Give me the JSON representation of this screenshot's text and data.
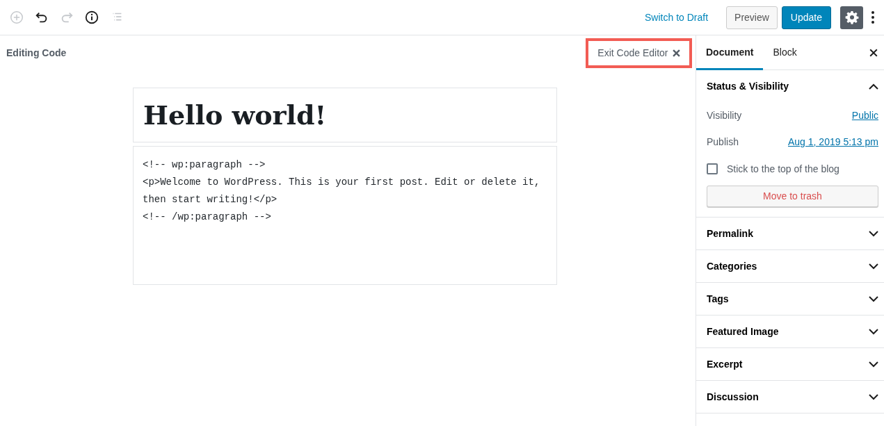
{
  "toolbar": {
    "tools": [
      {
        "kind": "add",
        "disabled": true
      },
      {
        "kind": "undo",
        "disabled": false
      },
      {
        "kind": "redo",
        "disabled": true
      },
      {
        "kind": "info",
        "disabled": false
      },
      {
        "kind": "outline",
        "disabled": true
      }
    ],
    "switch_link": "Switch to Draft",
    "preview_button": "Preview",
    "update_button": "Update",
    "settings_active": true
  },
  "editor": {
    "heading": "Editing Code",
    "exit_button": "Exit Code Editor",
    "exit_highlighted": true,
    "title": "Hello world!",
    "code_lines": [
      "<!-- wp:paragraph -->",
      "<p>Welcome to WordPress. This is your first post. Edit or delete it, then start writing!</p>",
      "<!-- /wp:paragraph -->"
    ]
  },
  "sidebar": {
    "tabs": [
      {
        "label": "Document",
        "selected": true
      },
      {
        "label": "Block",
        "selected": false
      }
    ],
    "panels": [
      {
        "title": "Status & Visibility",
        "expanded": true,
        "rows": [
          {
            "label": "Visibility",
            "value": "Public"
          },
          {
            "label": "Publish",
            "value": "Aug 1, 2019 5:13 pm"
          }
        ],
        "sticky": {
          "label": "Stick to the top of the blog",
          "checked": false
        },
        "trash_button": "Move to trash"
      },
      {
        "title": "Permalink",
        "expanded": false
      },
      {
        "title": "Categories",
        "expanded": false
      },
      {
        "title": "Tags",
        "expanded": false
      },
      {
        "title": "Featured Image",
        "expanded": false
      },
      {
        "title": "Excerpt",
        "expanded": false
      },
      {
        "title": "Discussion",
        "expanded": false
      }
    ]
  }
}
